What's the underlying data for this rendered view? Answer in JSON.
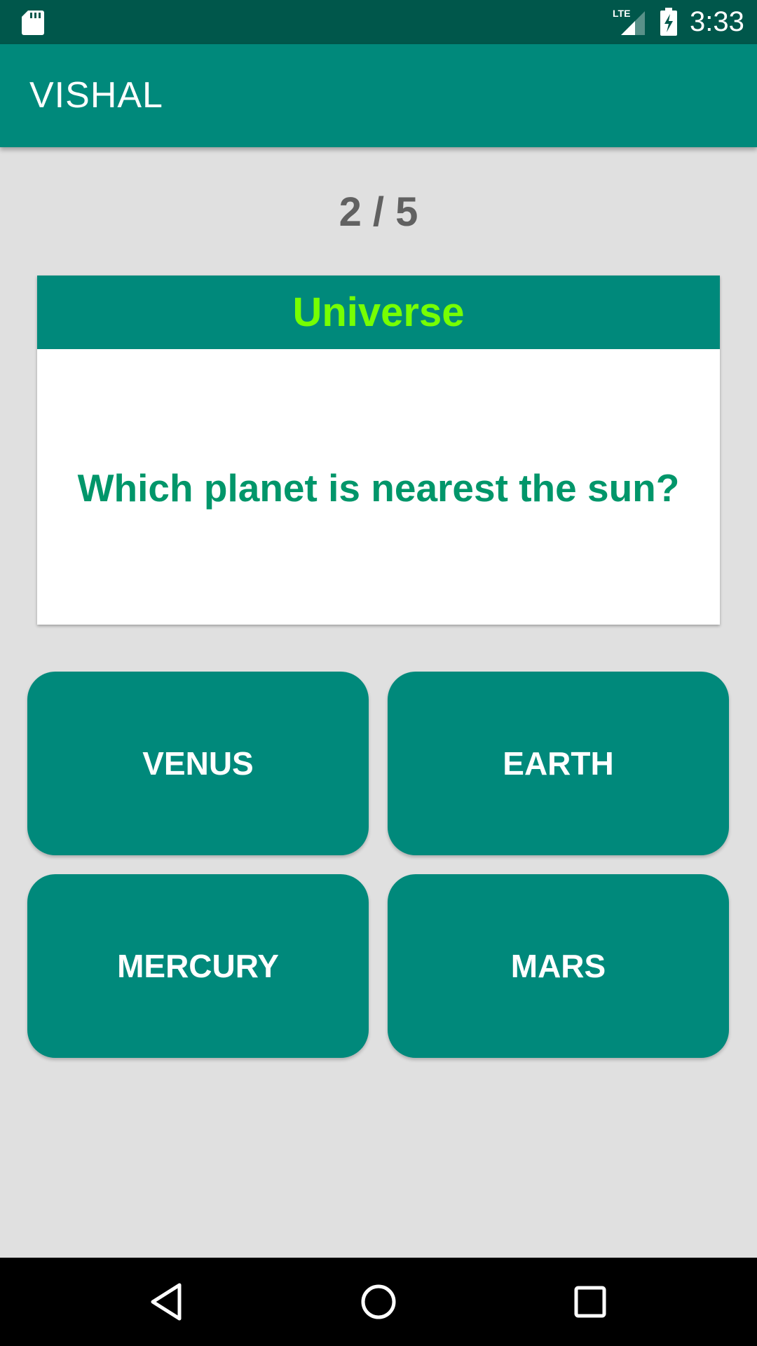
{
  "status_bar": {
    "time": "3:33",
    "network_label": "LTE",
    "icons": [
      "sd-card-icon",
      "lte-signal-icon",
      "battery-charging-icon"
    ]
  },
  "app_bar": {
    "title": "VISHAL"
  },
  "quiz": {
    "progress": "2 / 5",
    "category": "Universe",
    "question": "Which planet is nearest the sun?",
    "answers": [
      "VENUS",
      "EARTH",
      "MERCURY",
      "MARS"
    ]
  },
  "nav_bar": {
    "icons": [
      "back-icon",
      "home-icon",
      "recents-icon"
    ]
  },
  "colors": {
    "status_bar": "#00574b",
    "primary": "#00897b",
    "background": "#e0e0e0",
    "category_text": "#76ff03",
    "question_text": "#00966a",
    "progress_text": "#616161"
  }
}
